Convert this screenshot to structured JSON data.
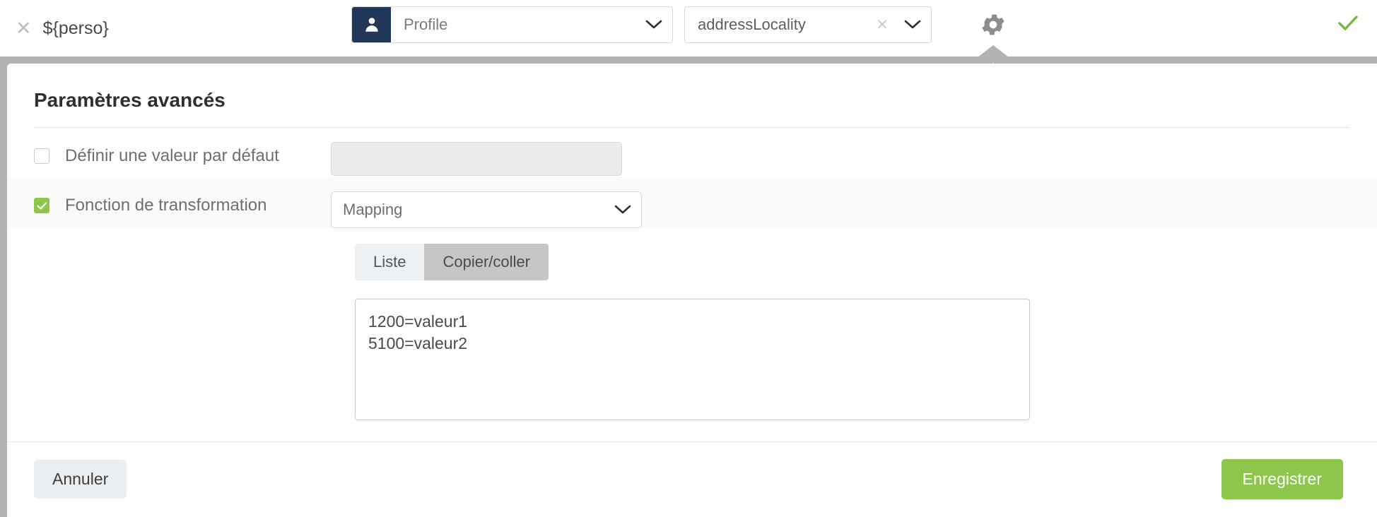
{
  "topbar": {
    "close_icon": "close-x-icon",
    "token_label": "${perso}",
    "profile_select": {
      "icon": "person-icon",
      "value": "Profile",
      "chevron_icon": "chevron-down-icon"
    },
    "field_select": {
      "value": "addressLocality",
      "clear_icon": "clear-x-icon",
      "chevron_icon": "chevron-down-icon"
    },
    "gear_icon": "gear-icon",
    "confirm_icon": "check-icon"
  },
  "panel": {
    "title": "Paramètres avancés",
    "rows": [
      {
        "checkbox_label": "Définir une valeur par défaut",
        "checked": false,
        "input_value": "",
        "input_placeholder": ""
      },
      {
        "checkbox_label": "Fonction de transformation",
        "checked": true,
        "select_value": "Mapping"
      }
    ],
    "tabs": [
      {
        "label": "Liste",
        "active": false
      },
      {
        "label": "Copier/coller",
        "active": true
      }
    ],
    "mapping_text": "1200=valeur1\n5100=valeur2",
    "resize_grip_icon": "resize-grip-icon"
  },
  "footer": {
    "cancel_label": "Annuler",
    "save_label": "Enregistrer"
  },
  "colors": {
    "accent_green": "#8cc64b",
    "profile_badge": "#22385a",
    "frame_grey": "#b3b3b3",
    "tab_active": "#c6c6c6"
  }
}
